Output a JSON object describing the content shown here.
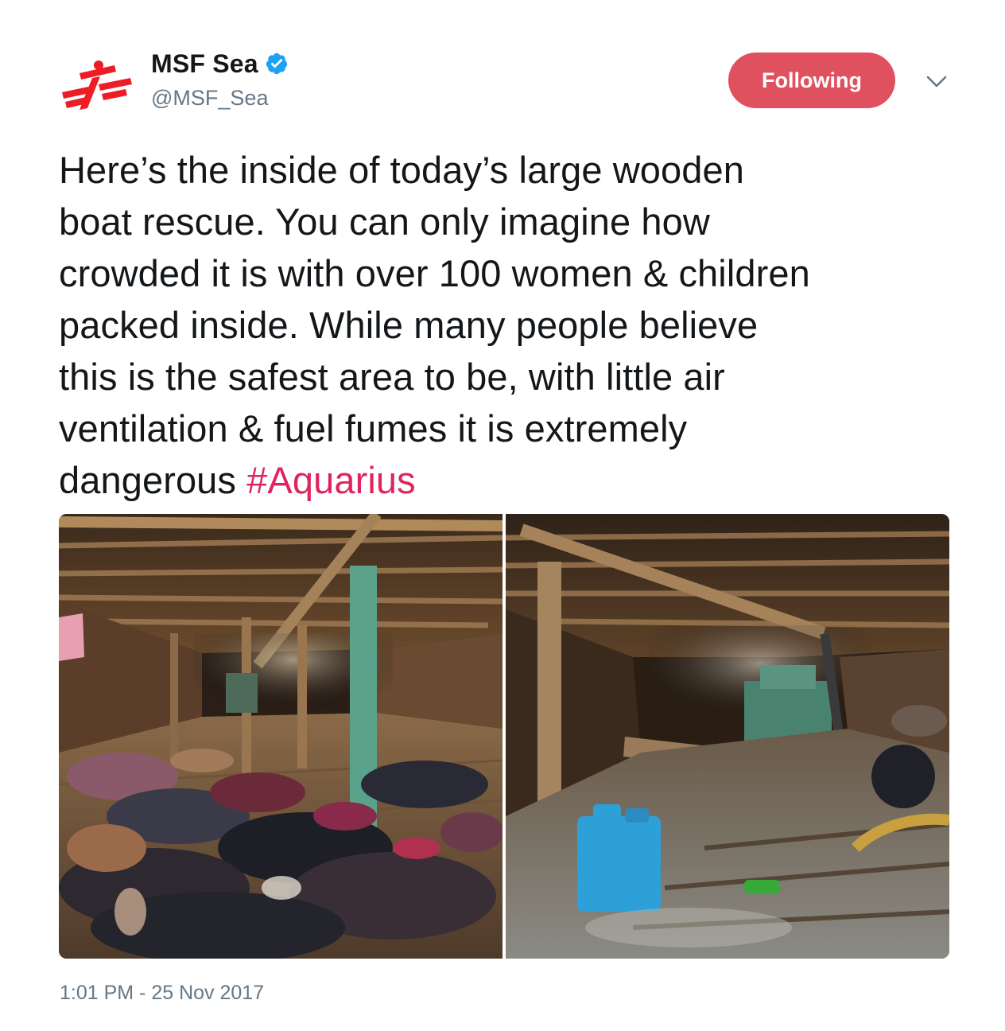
{
  "author": {
    "display_name": "MSF Sea",
    "handle": "@MSF_Sea",
    "verified": true,
    "avatar_icon": "msf-logo-icon"
  },
  "follow_button": {
    "label": "Following",
    "color": "#e0515f"
  },
  "menu": {
    "icon": "chevron-down-icon"
  },
  "tweet": {
    "lines": [
      "Here’s the inside of today’s large wooden",
      "boat rescue. You can only imagine how",
      "crowded it is with over 100 women & children",
      "packed inside. While many people believe",
      "this is the safest area to be, with little air",
      "ventilation & fuel fumes it is extremely"
    ],
    "last_line_text": "dangerous ",
    "hashtag": "#Aquarius",
    "hashtag_color": "#e0245e"
  },
  "media": {
    "count": 2,
    "photos": [
      {
        "description_icon": "boat-hold-clothes-photo"
      },
      {
        "description_icon": "boat-hold-engine-photo"
      }
    ]
  },
  "timestamp": "1:01 PM - 25 Nov 2017",
  "colors": {
    "text": "#14171a",
    "secondary": "#657786",
    "verified_blue": "#1da1f2",
    "msf_red": "#ee0000"
  }
}
